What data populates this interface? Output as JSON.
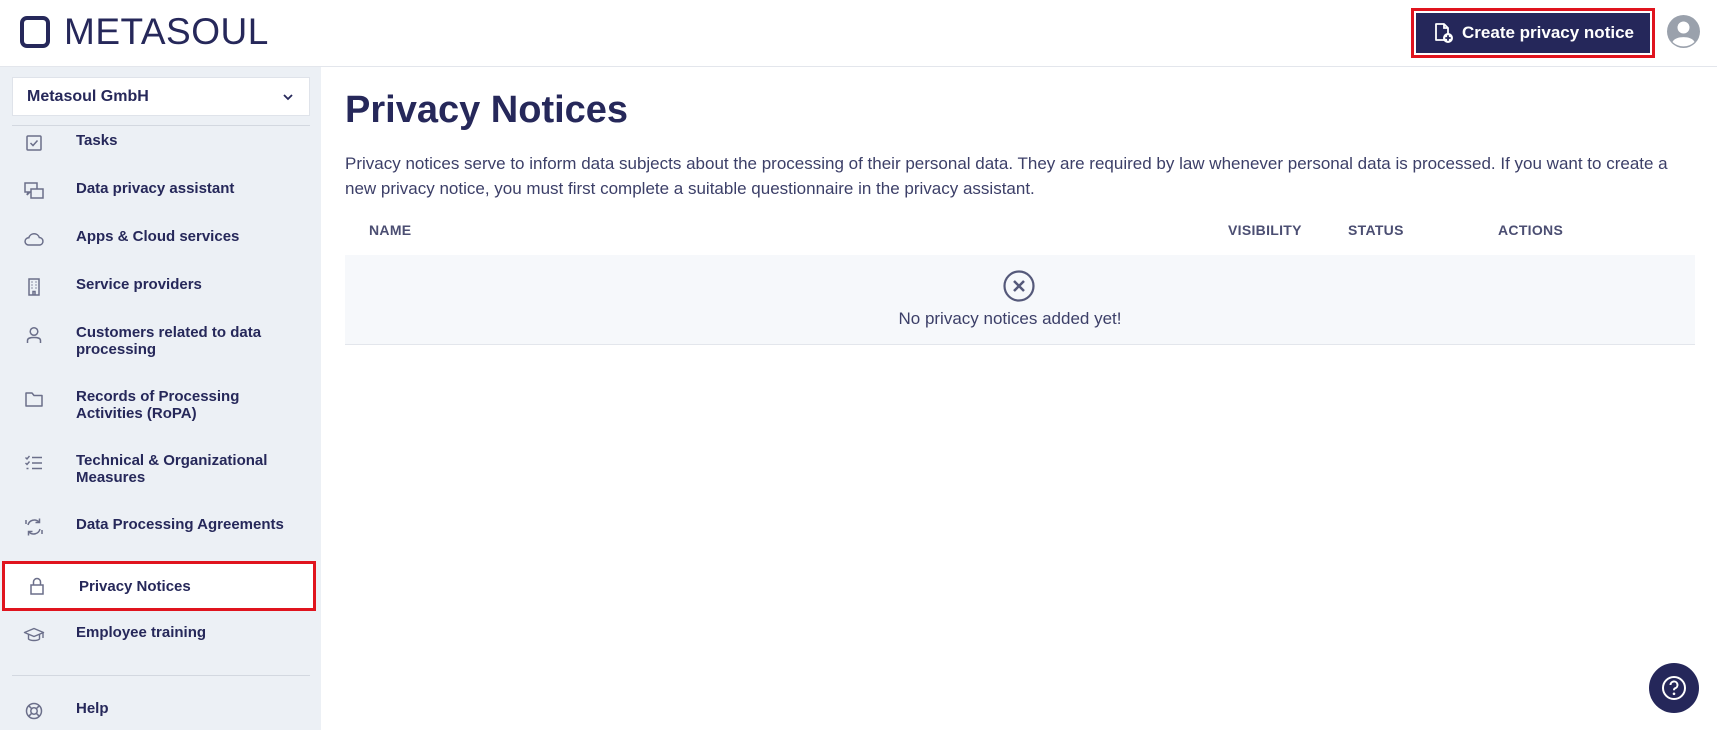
{
  "app": {
    "logo_text": "METASOUL"
  },
  "header": {
    "create_button_label": "Create privacy notice"
  },
  "sidebar": {
    "org_selector": "Metasoul GmbH",
    "items": [
      {
        "label": "Tasks",
        "icon": "checkbox-icon"
      },
      {
        "label": "Data privacy assistant",
        "icon": "chat-icon"
      },
      {
        "label": "Apps & Cloud services",
        "icon": "cloud-icon"
      },
      {
        "label": "Service providers",
        "icon": "building-icon"
      },
      {
        "label": "Customers related to data processing",
        "icon": "person-icon"
      },
      {
        "label": "Records of Processing Activities (RoPA)",
        "icon": "folder-icon"
      },
      {
        "label": "Technical & Organizational Measures",
        "icon": "checklist-icon"
      },
      {
        "label": "Data Processing Agreements",
        "icon": "sync-icon"
      },
      {
        "label": "Privacy Notices",
        "icon": "lock-icon",
        "active": true
      },
      {
        "label": "Employee training",
        "icon": "graduation-cap-icon"
      }
    ],
    "help_label": "Help"
  },
  "main": {
    "title": "Privacy Notices",
    "description": "Privacy notices serve to inform data subjects about the processing of their personal data. They are required by law whenever personal data is processed. If you want to create a new privacy notice, you must first complete a suitable questionnaire in the privacy assistant.",
    "table": {
      "columns": [
        "NAME",
        "VISIBILITY",
        "STATUS",
        "ACTIONS"
      ],
      "empty_message": "No privacy notices added yet!"
    }
  },
  "colors": {
    "brand": "#25275a",
    "highlight": "#e0141e",
    "sidebar_bg": "#ecf0f5"
  }
}
